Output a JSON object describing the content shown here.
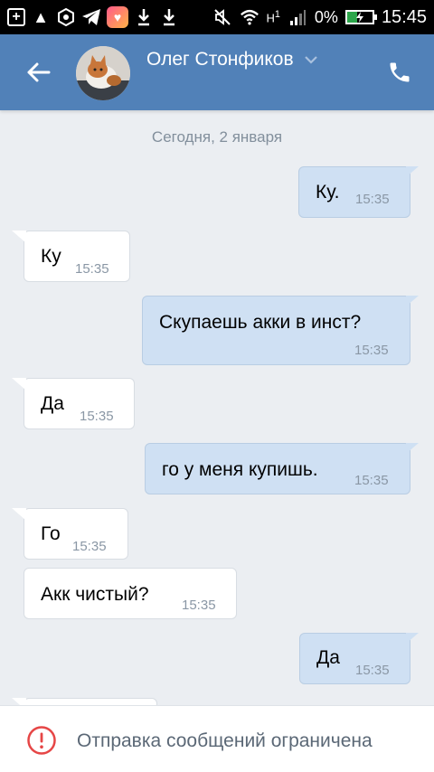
{
  "status_bar": {
    "time": "15:45",
    "battery_percent": "0%",
    "network": "H",
    "network_sup": "1",
    "icons": [
      "add-box-icon",
      "warning-icon",
      "settings-ring-icon",
      "telegram-icon",
      "likee-icon",
      "download-icon",
      "download-icon",
      "silent-icon",
      "wifi-icon",
      "signal-icon",
      "battery-charging-icon"
    ]
  },
  "header": {
    "contact_name": "Олег Стонфиков",
    "icons": {
      "back": "arrow-left-icon",
      "dropdown": "chevron-down-icon",
      "call": "phone-icon"
    }
  },
  "chat": {
    "date_divider": "Сегодня, 2 января",
    "messages": [
      {
        "dir": "out",
        "text": "Ку.",
        "time": "15:35"
      },
      {
        "dir": "in",
        "text": "Ку",
        "time": "15:35"
      },
      {
        "dir": "out",
        "text": "Скупаешь акки в инст?",
        "time": "15:35"
      },
      {
        "dir": "in",
        "text": "Да",
        "time": "15:35"
      },
      {
        "dir": "out",
        "text": "го у меня купишь.",
        "time": "15:35"
      },
      {
        "dir": "in",
        "text": "Го",
        "time": "15:35"
      },
      {
        "dir": "in",
        "text": "Акк чистый?",
        "time": "15:35"
      },
      {
        "dir": "out",
        "text": "Да",
        "time": "15:35"
      }
    ]
  },
  "bottom": {
    "notice": "Отправка сообщений ограничена",
    "icon": "alert-circle-icon"
  },
  "colors": {
    "header_bg": "#5181b8",
    "chat_bg": "#ebeef2",
    "outgoing_bubble": "#cfe0f3",
    "incoming_bubble": "#ffffff",
    "warning": "#e64646"
  }
}
